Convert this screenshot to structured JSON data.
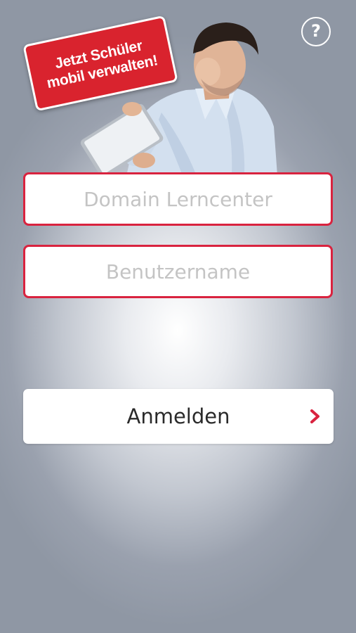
{
  "help": {
    "label": "?",
    "icon": "question-icon"
  },
  "promo": {
    "line1": "Jetzt Schüler",
    "line2": "mobil verwalten!"
  },
  "form": {
    "domain_placeholder": "Domain Lerncenter",
    "domain_value": "",
    "username_placeholder": "Benutzername",
    "username_value": ""
  },
  "login": {
    "label": "Anmelden",
    "icon": "chevron-right-icon"
  },
  "colors": {
    "accent": "#d9233f",
    "badge": "#d9232e",
    "background_edge": "#8f97a4",
    "background_center": "#ffffff"
  }
}
